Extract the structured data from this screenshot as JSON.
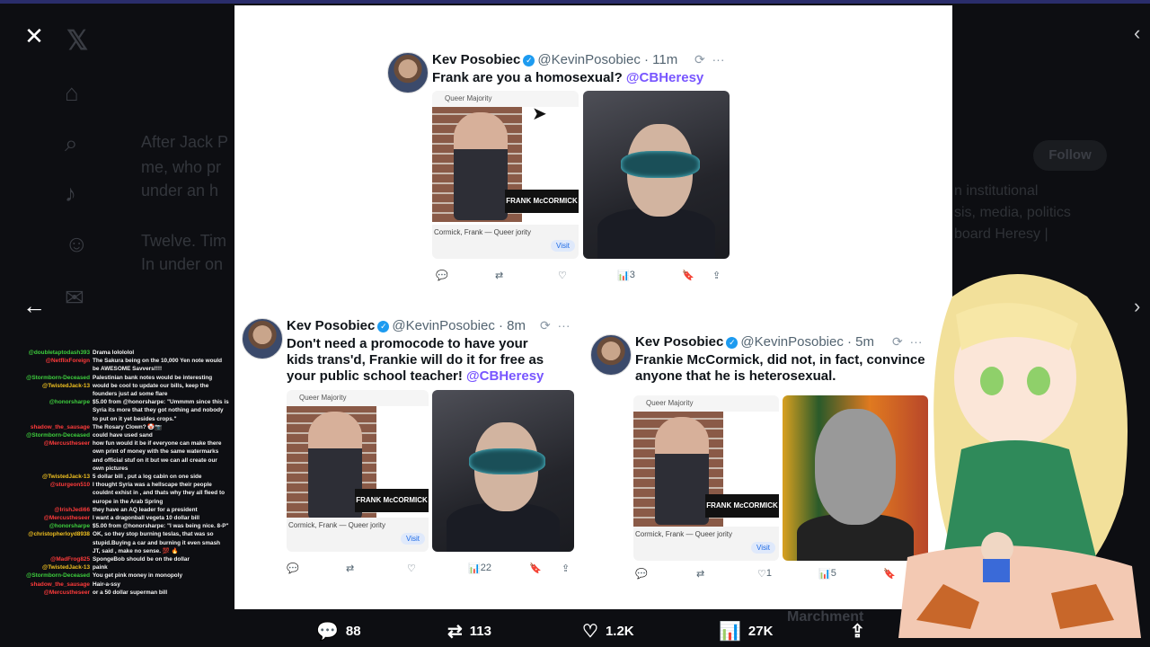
{
  "background": {
    "bg_text_lines": [
      "After Jack P",
      "me, who pr",
      "under an h",
      "Twelve. Tim",
      "In under on"
    ],
    "bg_right_lines": [
      "n institutional",
      "sis, media, politics",
      "board Heresy |"
    ],
    "follow_label": "Follow",
    "bottom_right_text": "Marchment"
  },
  "viewer": {
    "close_label": "✕",
    "back_label": "←"
  },
  "tweets": [
    {
      "name": "Kev Posobiec",
      "handle": "@KevinPosobiec · 11m",
      "text": "Frank are you a homosexual?",
      "mention": "@CBHeresy",
      "views": "3",
      "left_image": {
        "banner": "Queer Majority",
        "name_tag": "FRANK McCORMICK",
        "caption": "Cormick, Frank — Queer jority",
        "visit": "Visit"
      }
    },
    {
      "name": "Kev Posobiec",
      "handle": "@KevinPosobiec · 8m",
      "text": "Don't need a promocode to have your kids trans'd, Frankie will do it for free as your public school teacher!",
      "mention": "@CBHeresy",
      "views": "22",
      "left_image": {
        "banner": "Queer Majority",
        "name_tag": "FRANK McCORMICK",
        "caption": "Cormick, Frank — Queer jority",
        "visit": "Visit"
      }
    },
    {
      "name": "Kev Posobiec",
      "handle": "@KevinPosobiec · 5m",
      "text": "Frankie McCormick, did not, in fact, convince anyone that he is heterosexual.",
      "mention": "",
      "likes": "1",
      "views": "5",
      "left_image": {
        "banner": "Queer Majority",
        "name_tag": "FRANK McCORMICK",
        "caption": "Cormick, Frank — Queer jority",
        "visit": "Visit"
      }
    }
  ],
  "stats": {
    "replies": "88",
    "reposts": "113",
    "likes": "1.2K",
    "views": "27K"
  },
  "chat": [
    {
      "user": "@doubletaptodash393",
      "msg": "Drama lolololol",
      "color": "#3ecf3e"
    },
    {
      "user": "@NetflixForeign",
      "msg": "The Sakura being on the 10,000 Yen note would be AWESOME Savvers!!!!",
      "color": "#ff3b3b"
    },
    {
      "user": "@Stormborn-Deceased",
      "msg": "Palestinian bank notes would be interesting",
      "color": "#3ecf3e"
    },
    {
      "user": "@TwistedJack-13",
      "msg": "would be cool to update our bills, keep the founders just ad some flare",
      "color": "#f0c020"
    },
    {
      "user": "@honorsharpe",
      "msg": "$5.00 from @honorsharpe: \"Ummmm since this is Syria its more that they got nothing and nobody to put on it yet besides crops.\"",
      "color": "#3ecf3e"
    },
    {
      "user": "shadow_the_sausage",
      "msg": "The Rosary Clown? 🤡📷",
      "color": "#ff3b3b"
    },
    {
      "user": "@Stormborn-Deceased",
      "msg": "could have used sand",
      "color": "#3ecf3e"
    },
    {
      "user": "@Mercustheseer",
      "msg": "how fun would it be if everyone can make there own print of money with the same watermarks and official stuf on it but we can all create our own pictures",
      "color": "#ff3b3b"
    },
    {
      "user": "@TwistedJack-13",
      "msg": "5 dollar bill , put a log cabin on one side",
      "color": "#f0c020"
    },
    {
      "user": "@sturgeon510",
      "msg": "I thought Syria was a hellscape their people couldnt exhist in , and thats why they all fleed to europe in the Arab Spring",
      "color": "#ff3b3b"
    },
    {
      "user": "@IrishJedi66",
      "msg": "they have an AQ leader for a president",
      "color": "#ff3b3b"
    },
    {
      "user": "@Mercustheseer",
      "msg": "I want a dragonball vegeta 10 dollar bill",
      "color": "#ff3b3b"
    },
    {
      "user": "@honorsharpe",
      "msg": "$5.00 from @honorsharpe: \"I was being nice. 8-P\"",
      "color": "#3ecf3e"
    },
    {
      "user": "@christopherloyd8938",
      "msg": "OK, so they stop burning teslas, that was so stupid.Buying a car and burning it even smash JT, said , make no sense. 💯 🔥",
      "color": "#f0c020"
    },
    {
      "user": "@MadFrog825",
      "msg": "SpongeBob should be on the dollar",
      "color": "#ff3b3b"
    },
    {
      "user": "@TwistedJack-13",
      "msg": "paink",
      "color": "#f0c020"
    },
    {
      "user": "@Stormborn-Deceased",
      "msg": "You get pink money in monopoly",
      "color": "#3ecf3e"
    },
    {
      "user": "shadow_the_sausage",
      "msg": "Hair-a-ssy",
      "color": "#ff3b3b"
    },
    {
      "user": "@Mercustheseer",
      "msg": "or a 50 dollar superman bill",
      "color": "#ff3b3b"
    }
  ]
}
